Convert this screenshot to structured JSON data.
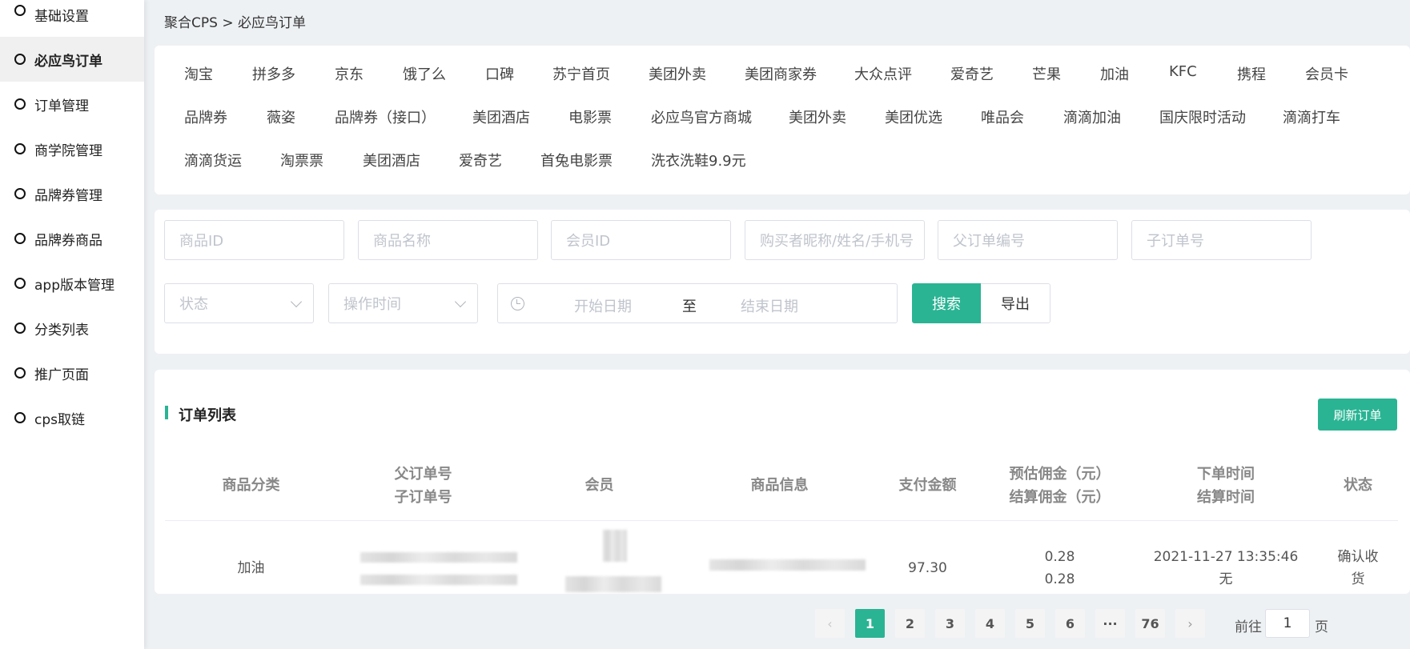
{
  "sidebar": {
    "items": [
      {
        "label": "基础设置"
      },
      {
        "label": "必应鸟订单"
      },
      {
        "label": "订单管理"
      },
      {
        "label": "商学院管理"
      },
      {
        "label": "品牌券管理"
      },
      {
        "label": "品牌券商品"
      },
      {
        "label": "app版本管理"
      },
      {
        "label": "分类列表"
      },
      {
        "label": "推广页面"
      },
      {
        "label": "cps取链"
      }
    ],
    "active_index": 1
  },
  "breadcrumb": "聚合CPS > 必应鸟订单",
  "categories": {
    "row1": [
      "淘宝",
      "拼多多",
      "京东",
      "饿了么",
      "口碑",
      "苏宁首页",
      "美团外卖",
      "美团商家券",
      "大众点评",
      "爱奇艺",
      "芒果",
      "加油",
      "KFC",
      "携程",
      "会员卡"
    ],
    "row2": [
      "品牌券",
      "薇姿",
      "品牌券（接口）",
      "美团酒店",
      "电影票",
      "必应鸟官方商城",
      "美团外卖",
      "美团优选",
      "唯品会",
      "滴滴加油",
      "国庆限时活动",
      "滴滴打车"
    ],
    "row3": [
      "滴滴货运",
      "淘票票",
      "美团酒店",
      "爱奇艺",
      "首兔电影票",
      "洗衣洗鞋9.9元"
    ]
  },
  "filters": {
    "product_id": "商品ID",
    "product_name": "商品名称",
    "member_id": "会员ID",
    "buyer": "购买者昵称/姓名/手机号",
    "parent_order": "父订单编号",
    "child_order": "子订单号",
    "status": "状态",
    "op_time": "操作时间",
    "start_date": "开始日期",
    "date_sep": "至",
    "end_date": "结束日期",
    "search_label": "搜索",
    "export_label": "导出"
  },
  "order_list": {
    "title": "订单列表",
    "refresh_label": "刷新订单",
    "headers": {
      "category": "商品分类",
      "parent_order": "父订单号",
      "child_order": "子订单号",
      "member": "会员",
      "product_info": "商品信息",
      "amount": "支付金额",
      "est_commission": "预估佣金（元）",
      "settle_commission": "结算佣金（元）",
      "order_time": "下单时间",
      "settle_time": "结算时间",
      "status": "状态"
    },
    "rows": [
      {
        "category": "加油",
        "amount": "97.30",
        "est_commission": "0.28",
        "settle_commission": "0.28",
        "order_time": "2021-11-27 13:35:46",
        "settle_time": "无",
        "status_line1": "确认收",
        "status_line2": "货"
      }
    ]
  },
  "pagination": {
    "prev": "‹",
    "pages": [
      "1",
      "2",
      "3",
      "4",
      "5",
      "6"
    ],
    "ellipsis": "···",
    "last": "76",
    "next": "›",
    "current": 1,
    "goto_prefix": "前往",
    "goto_value": "1",
    "goto_suffix": "页"
  }
}
